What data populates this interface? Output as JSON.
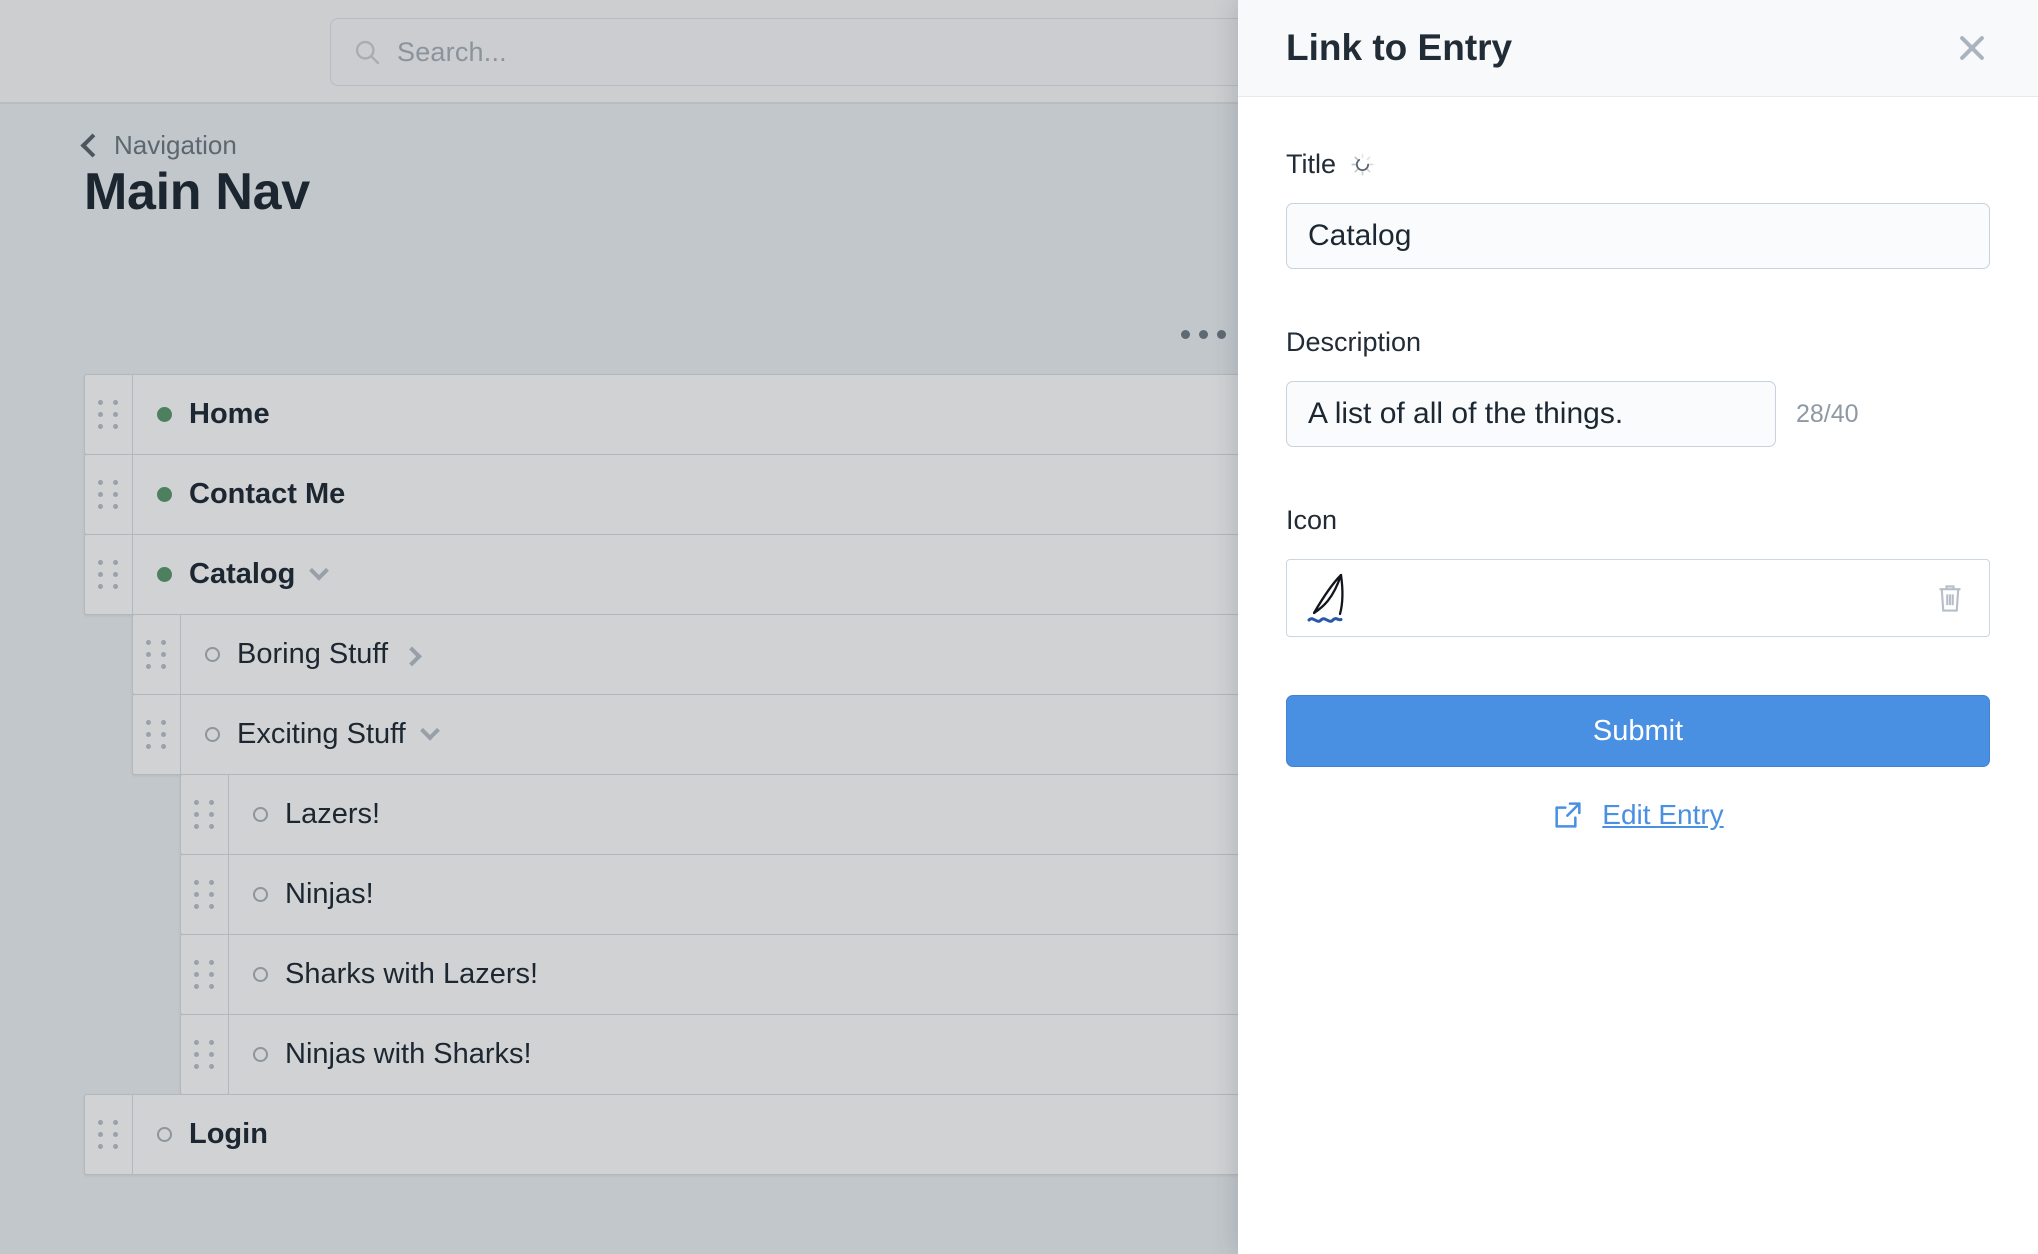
{
  "topbar": {
    "search": {
      "placeholder": "Search...",
      "value": "",
      "icon": "search-icon"
    }
  },
  "main": {
    "breadcrumb": {
      "back_icon": "chevron-left-icon",
      "label": "Navigation"
    },
    "page_title": "Main Nav",
    "overflow_menu_icon": "ellipsis-icon",
    "tree": [
      {
        "label": "Home",
        "level": 1,
        "status": "on",
        "chevron": "none",
        "handle_icon": "drag-handle-icon"
      },
      {
        "label": "Contact Me",
        "level": 1,
        "status": "on",
        "chevron": "none",
        "handle_icon": "drag-handle-icon"
      },
      {
        "label": "Catalog",
        "level": 1,
        "status": "on",
        "chevron": "down",
        "handle_icon": "drag-handle-icon"
      },
      {
        "label": "Boring Stuff",
        "level": 2,
        "status": "off",
        "chevron": "right",
        "handle_icon": "drag-handle-icon"
      },
      {
        "label": "Exciting Stuff",
        "level": 2,
        "status": "off",
        "chevron": "down",
        "handle_icon": "drag-handle-icon"
      },
      {
        "label": "Lazers!",
        "level": 3,
        "status": "off",
        "chevron": "none",
        "handle_icon": "drag-handle-icon"
      },
      {
        "label": "Ninjas!",
        "level": 3,
        "status": "off",
        "chevron": "none",
        "handle_icon": "drag-handle-icon"
      },
      {
        "label": "Sharks with Lazers!",
        "level": 3,
        "status": "off",
        "chevron": "none",
        "handle_icon": "drag-handle-icon"
      },
      {
        "label": "Ninjas with Sharks!",
        "level": 3,
        "status": "off",
        "chevron": "none",
        "handle_icon": "drag-handle-icon"
      },
      {
        "label": "Login",
        "level": 1,
        "status": "off",
        "chevron": "none",
        "handle_icon": "drag-handle-icon"
      }
    ]
  },
  "panel": {
    "title": "Link to Entry",
    "close_icon": "close-icon",
    "title_field": {
      "label": "Title",
      "loading_icon": "spinner-icon",
      "value": "Catalog",
      "placeholder": ""
    },
    "description_field": {
      "label": "Description",
      "value": "A list of all of the things.",
      "placeholder": "",
      "counter": "28/40"
    },
    "icon_field": {
      "label": "Icon",
      "icon": "shark-fin-icon",
      "delete_icon": "trash-icon"
    },
    "submit_label": "Submit",
    "edit_entry": {
      "label": "Edit Entry",
      "icon": "external-link-icon"
    }
  },
  "colors": {
    "accent": "#4a90e2",
    "status_on": "#4e8060",
    "status_off": "#8d959d",
    "panel_bg": "#ffffff",
    "app_bg": "#c2c7cb"
  }
}
